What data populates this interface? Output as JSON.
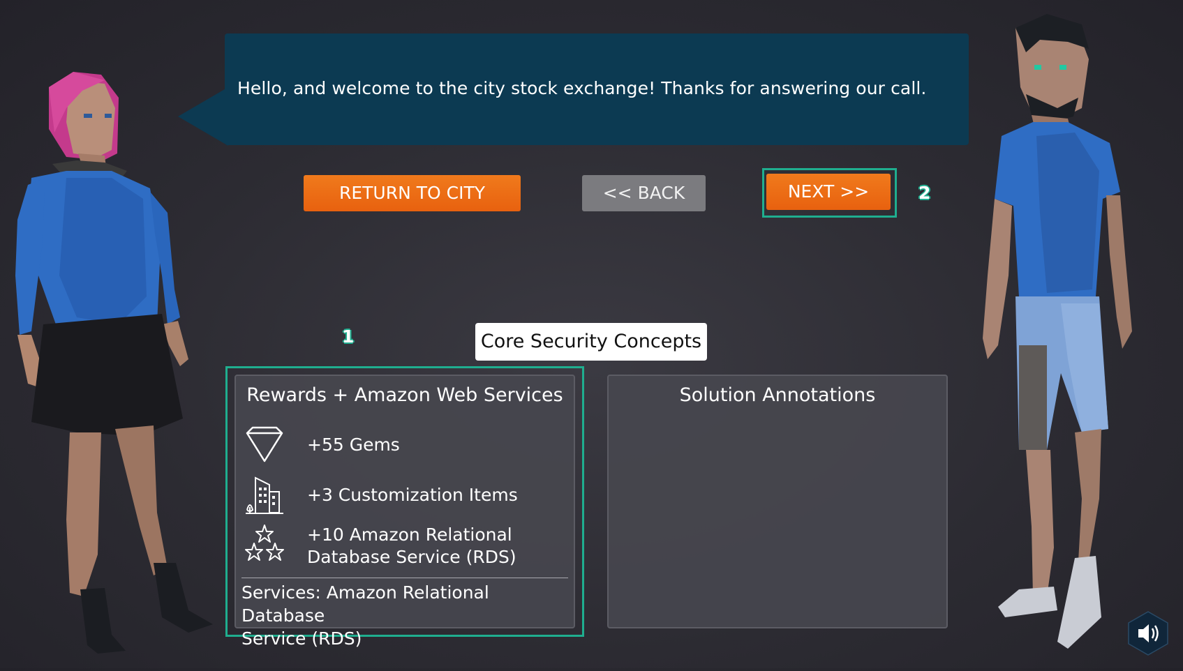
{
  "dialogue": {
    "text": "Hello, and welcome to the city stock exchange! Thanks for answering our call."
  },
  "buttons": {
    "return_label": "RETURN TO CITY",
    "back_label": "<< BACK",
    "next_label": "NEXT >>"
  },
  "markers": {
    "rewards": "1",
    "next": "2"
  },
  "concept_title": "Core Security Concepts",
  "rewards_panel": {
    "title": "Rewards + Amazon Web Services",
    "items": [
      {
        "icon": "gem-icon",
        "label": "+55 Gems"
      },
      {
        "icon": "building-icon",
        "label": "+3 Customization Items"
      },
      {
        "icon": "stars-icon",
        "label_line1": "+10 Amazon Relational",
        "label_line2": "Database Service (RDS)"
      }
    ],
    "services_line1": "Services: Amazon Relational Database",
    "services_line2": "Service (RDS)"
  },
  "solutions_panel": {
    "title": "Solution Annotations"
  },
  "colors": {
    "speech_bg": "#0c3a52",
    "button_orange": "#e8610f",
    "button_gray": "#7b7b7f",
    "highlight": "#1fae8f"
  },
  "icons": [
    "gem-icon",
    "building-icon",
    "stars-icon",
    "speaker-icon"
  ]
}
